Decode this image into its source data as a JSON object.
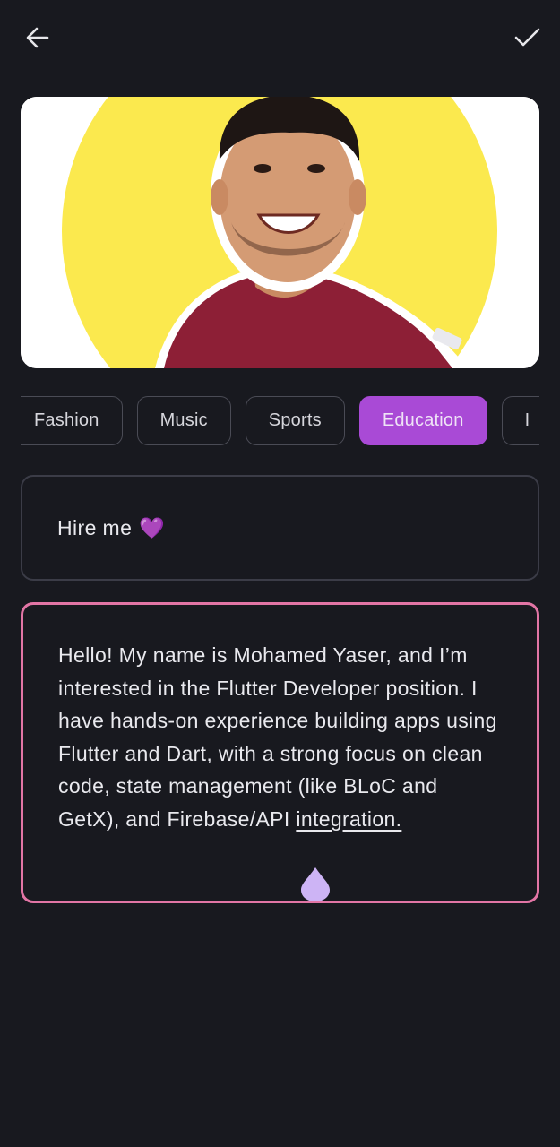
{
  "header": {
    "back_icon": "arrow-left-icon",
    "done_icon": "check-icon"
  },
  "photo": {
    "alt": "profile photo"
  },
  "categories": {
    "items": [
      {
        "label": "Fashion",
        "selected": false
      },
      {
        "label": "Music",
        "selected": false
      },
      {
        "label": "Sports",
        "selected": false
      },
      {
        "label": "Education",
        "selected": true
      },
      {
        "label": "I",
        "selected": false
      }
    ]
  },
  "title_field": {
    "value": "Hire me",
    "emoji": "💜"
  },
  "description_field": {
    "value_main": "Hello! My name is Mohamed Yaser, and I’m interested in the Flutter Developer position. I have hands-on experience building apps using Flutter and Dart, with a strong focus on clean code, state management (like BLoC and GetX), and Firebase/API ",
    "value_underlined": "integration."
  },
  "colors": {
    "background": "#18191f",
    "accent": "#a94ad6",
    "focus_border": "#e275a5",
    "cursor_handle": "#cdb4f5"
  }
}
